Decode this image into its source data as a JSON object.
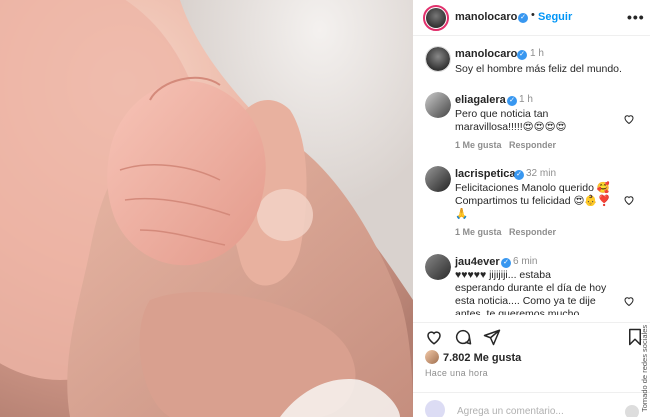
{
  "post": {
    "author": "manolocaro",
    "follow_label": "Seguir",
    "more_label": "•••",
    "caption_author": "manolocaro",
    "caption_time": "1 h",
    "caption_text": "Soy el hombre más feliz del mundo."
  },
  "comments": [
    {
      "user": "eliagalera",
      "time": "1 h",
      "text1": "Pero que noticia tan",
      "text2": "maravillosa!!!!!😍😍😍😍",
      "likes": "1 Me gusta",
      "reply": "Responder"
    },
    {
      "user": "lacrispetica",
      "time": "32 min",
      "text1": "Felicitaciones Manolo querido 🥰",
      "text2": "Compartimos tu felicidad 😍👶❣️",
      "text3": "🙏",
      "likes": "1 Me gusta",
      "reply": "Responder"
    },
    {
      "user": "jau4ever",
      "time": "6 min",
      "text1": "♥♥♥♥♥ jijijiji... estaba",
      "text2": "esperando durante el día de hoy",
      "text3": "esta noticia.... Como ya te dije",
      "text4": "antes, te queremos mucho"
    }
  ],
  "footer": {
    "likes_count": "7.802 Me gusta",
    "ago": "Hace una hora",
    "add_comment_placeholder": "Agrega un comentario..."
  },
  "credit": "Tomado de redes sociales",
  "colors": {
    "accent": "#0095f6",
    "verified": "#3897f0",
    "text": "#262626",
    "muted": "#8e8e8e"
  }
}
